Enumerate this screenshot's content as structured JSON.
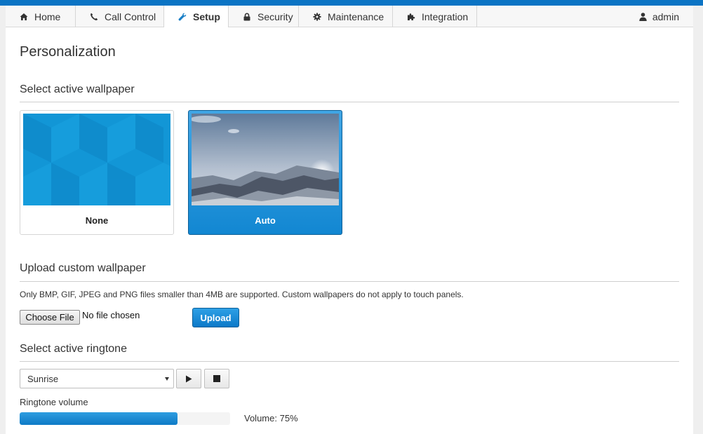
{
  "nav": {
    "tabs": [
      {
        "label": "Home",
        "icon": "home-icon"
      },
      {
        "label": "Call Control",
        "icon": "phone-icon"
      },
      {
        "label": "Setup",
        "icon": "wrench-icon",
        "active": true
      },
      {
        "label": "Security",
        "icon": "lock-icon"
      },
      {
        "label": "Maintenance",
        "icon": "gear-icon"
      },
      {
        "label": "Integration",
        "icon": "puzzle-icon"
      }
    ],
    "user": "admin"
  },
  "page": {
    "title": "Personalization"
  },
  "wallpaper": {
    "section_title": "Select active wallpaper",
    "options": [
      {
        "label": "None",
        "selected": false
      },
      {
        "label": "Auto",
        "selected": true
      }
    ]
  },
  "upload": {
    "section_title": "Upload custom wallpaper",
    "note": "Only BMP, GIF, JPEG and PNG files smaller than 4MB are supported. Custom wallpapers do not apply to touch panels.",
    "choose_label": "Choose File",
    "file_status": "No file chosen",
    "upload_label": "Upload"
  },
  "ringtone": {
    "section_title": "Select active ringtone",
    "selected": "Sunrise",
    "volume_label": "Ringtone volume",
    "volume_percent": 75,
    "volume_text": "Volume: 75%"
  },
  "colors": {
    "accent": "#0b74c4",
    "selected_card": "#1a8fd8"
  }
}
